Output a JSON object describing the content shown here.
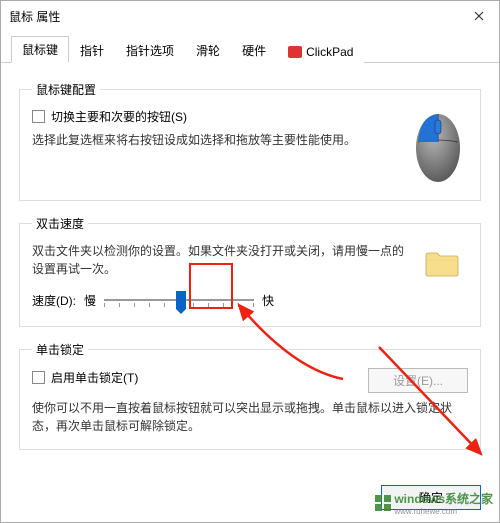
{
  "window": {
    "title": "鼠标 属性"
  },
  "tabs": {
    "items": [
      {
        "label": "鼠标键"
      },
      {
        "label": "指针"
      },
      {
        "label": "指针选项"
      },
      {
        "label": "滑轮"
      },
      {
        "label": "硬件"
      },
      {
        "label": "ClickPad"
      }
    ],
    "active_index": 0
  },
  "group_config": {
    "legend": "鼠标键配置",
    "checkbox_label": "切换主要和次要的按钮(S)",
    "desc": "选择此复选框来将右按钮设成如选择和拖放等主要性能使用。"
  },
  "group_speed": {
    "legend": "双击速度",
    "desc": "双击文件夹以检测你的设置。如果文件夹没打开或关闭，请用慢一点的设置再试一次。",
    "label": "速度(D):",
    "slow": "慢",
    "fast": "快"
  },
  "group_lock": {
    "legend": "单击锁定",
    "checkbox_label": "启用单击锁定(T)",
    "settings_btn": "设置(E)...",
    "desc": "使你可以不用一直按着鼠标按钮就可以突出显示或拖拽。单击鼠标以进入锁定状态，再次单击鼠标可解除锁定。"
  },
  "footer": {
    "ok": "确定"
  },
  "watermark": {
    "text": "windows系统之家",
    "url": "www.ruhewe.com"
  }
}
